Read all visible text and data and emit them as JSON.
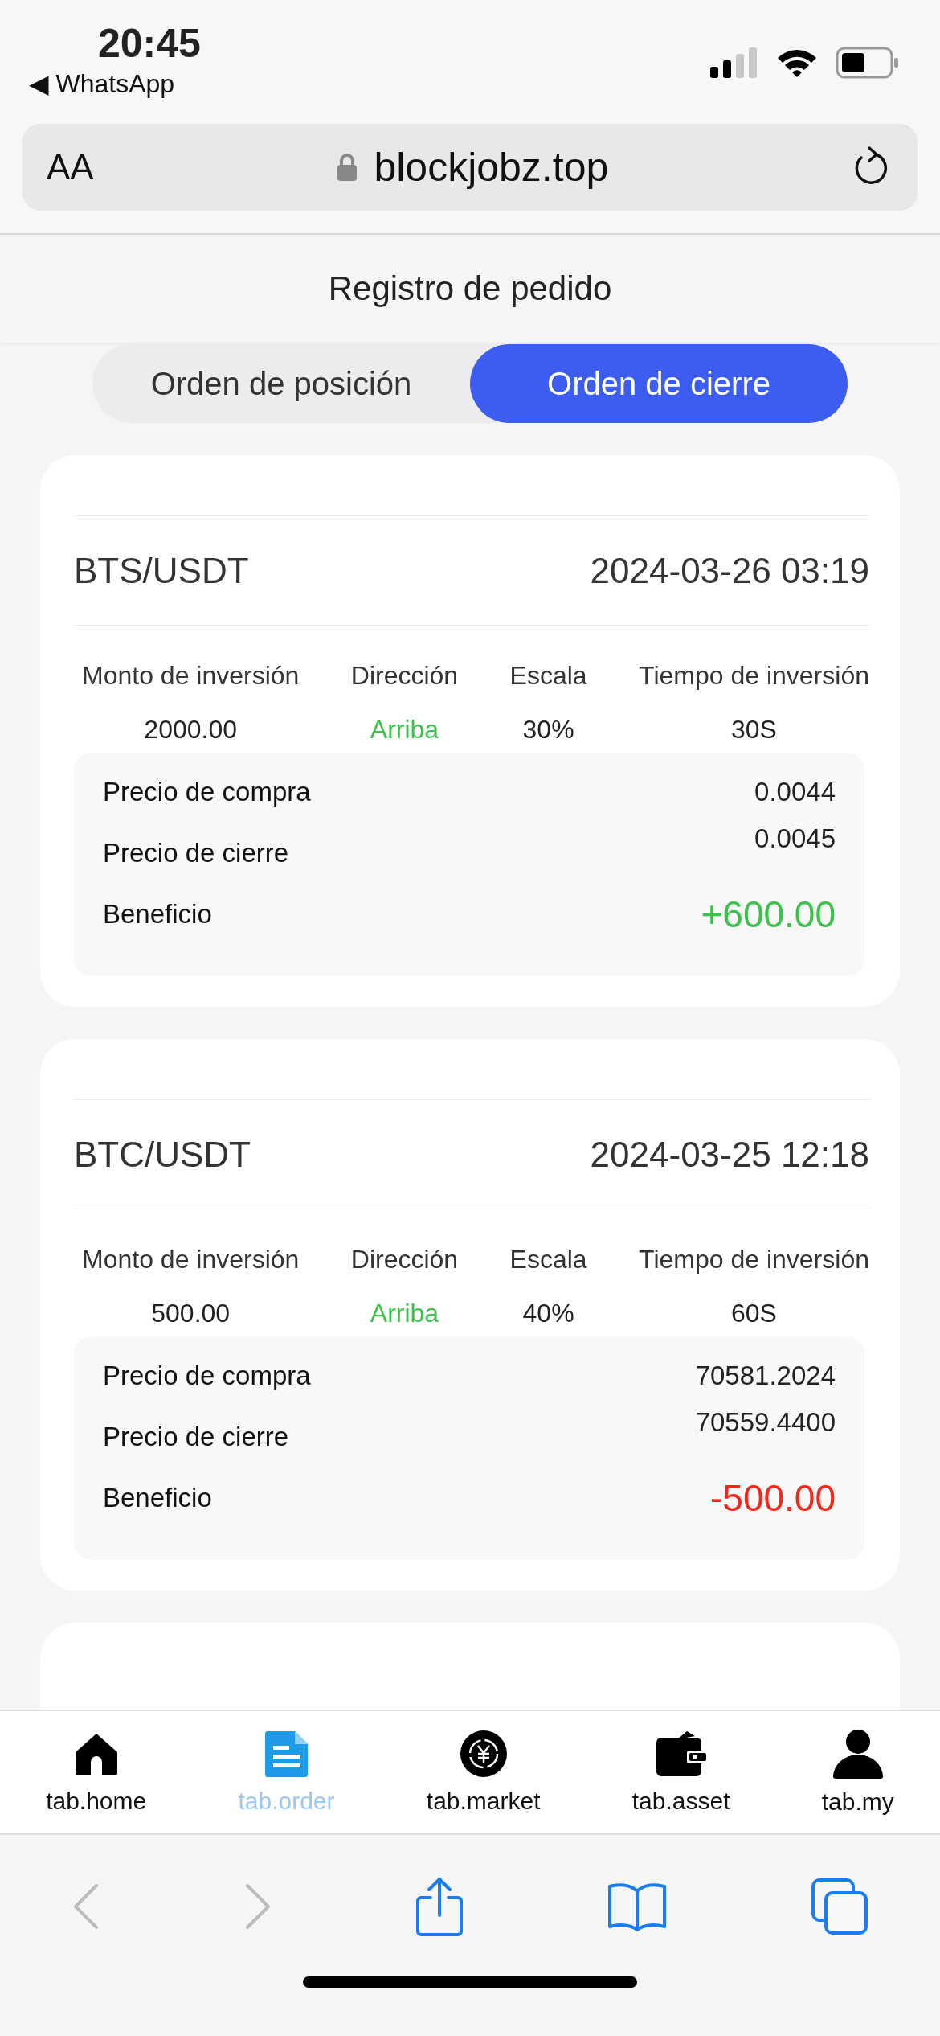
{
  "status_bar": {
    "time": "20:45",
    "back_app": "◀ WhatsApp"
  },
  "browser": {
    "text_size": "AA",
    "url": "blockjobz.top"
  },
  "header": {
    "title": "Registro de pedido"
  },
  "tabs": [
    {
      "label": "Orden de posición",
      "selected": false
    },
    {
      "label": "Orden de cierre",
      "selected": true
    }
  ],
  "orders": [
    {
      "pair": "BTS/USDT",
      "datetime": "2024-03-26 03:19",
      "columns": [
        "Monto de inversión",
        "Dirección",
        "Escala",
        "Tiempo de inversión"
      ],
      "amount": "2000.00",
      "direction": {
        "text": "Arriba",
        "color": "#3cc24b"
      },
      "scale": "30%",
      "time": "30S",
      "buy_label": "Precio de compra",
      "buy_price": "0.0044",
      "close_label": "Precio de cierre",
      "close_price": "0.0045",
      "profit_label": "Beneficio",
      "profit": {
        "text": "+600.00",
        "color": "#3cc24b"
      }
    },
    {
      "pair": "BTC/USDT",
      "datetime": "2024-03-25 12:18",
      "columns": [
        "Monto de inversión",
        "Dirección",
        "Escala",
        "Tiempo de inversión"
      ],
      "amount": "500.00",
      "direction": {
        "text": "Arriba",
        "color": "#3cc24b"
      },
      "scale": "40%",
      "time": "60S",
      "buy_label": "Precio de compra",
      "buy_price": "70581.2024",
      "close_label": "Precio de cierre",
      "close_price": "70559.4400",
      "profit_label": "Beneficio",
      "profit": {
        "text": "-500.00",
        "color": "#f0271c"
      }
    }
  ],
  "tab_bar": [
    {
      "label": "tab.home",
      "kind": "home",
      "selected": false
    },
    {
      "label": "tab.order",
      "kind": "order",
      "selected": true
    },
    {
      "label": "tab.market",
      "kind": "market",
      "selected": false
    },
    {
      "label": "tab.asset",
      "kind": "asset",
      "selected": false
    },
    {
      "label": "tab.my",
      "kind": "my",
      "selected": false
    }
  ]
}
